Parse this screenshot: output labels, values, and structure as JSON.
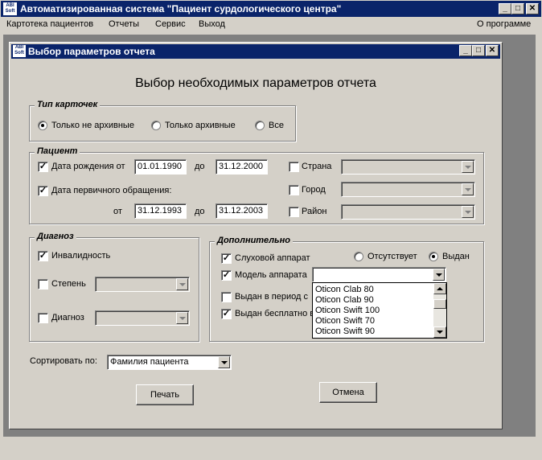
{
  "app": {
    "title": "Автоматизированная система \"Пациент сурдологического центра\"",
    "icon_text": "ABI Soft",
    "caption_buttons": [
      "_",
      "□",
      "✕"
    ]
  },
  "menu": {
    "items": [
      "Картотека пациентов",
      "Отчеты",
      "Сервис",
      "Выход"
    ],
    "about": "О программе"
  },
  "dialog": {
    "title": "Выбор параметров отчета",
    "heading": "Выбор необходимых параметров отчета",
    "card_type": {
      "legend": "Тип карточек",
      "options": [
        "Только не архивные",
        "Только архивные",
        "Все"
      ],
      "selected": 0
    },
    "patient": {
      "legend": "Пациент",
      "birth_label": "Дата рождения от",
      "birth_from": "01.01.1990",
      "to_label": "до",
      "birth_to": "31.12.2000",
      "first_visit_label": "Дата первичного обращения:",
      "from_label": "от",
      "visit_from": "31.12.1993",
      "visit_to": "31.12.2003",
      "country_label": "Страна",
      "city_label": "Город",
      "district_label": "Район"
    },
    "diagnosis": {
      "legend": "Диагноз",
      "disability_label": "Инвалидность",
      "degree_label": "Степень",
      "diagnosis_label": "Диагноз"
    },
    "additional": {
      "legend": "Дополнительно",
      "hearing_aid_label": "Слуховой аппарат",
      "absent_label": "Отсутствует",
      "issued_label": "Выдан",
      "model_label": "Модель аппарата",
      "model_value": "",
      "issued_period_label": "Выдан в период с",
      "issued_free_label": "Выдан бесплатно в",
      "model_options": [
        "Oticon Clab 80",
        "Oticon Clab 90",
        "Oticon Swift 100",
        "Oticon Swift 70",
        "Oticon Swift 90"
      ]
    },
    "sort_label": "Сортировать по:",
    "sort_value": "Фамилия пациента",
    "print_button": "Печать",
    "cancel_button": "Отмена"
  }
}
